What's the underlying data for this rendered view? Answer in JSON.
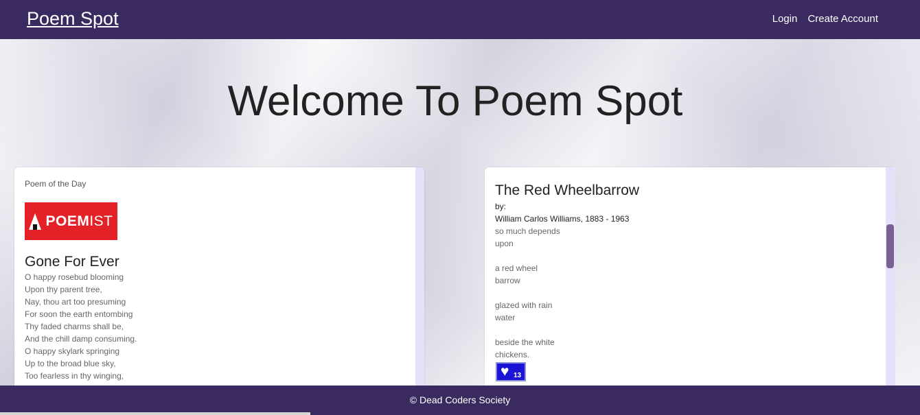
{
  "navbar": {
    "brand": "Poem Spot",
    "links": [
      "Login",
      "Create Account"
    ]
  },
  "hero": {
    "title": "Welcome To Poem Spot"
  },
  "poem_of_day": {
    "eyebrow": "Poem of the Day",
    "logo": {
      "prefix": "POEM",
      "suffix": "IST"
    },
    "title": "Gone For Ever",
    "lines": [
      "O happy rosebud blooming",
      "Upon thy parent tree,",
      "Nay, thou art too presuming",
      "For soon the earth entombing",
      "Thy faded charms shall be,",
      "And the chill damp consuming.",
      "O happy skylark springing",
      "Up to the broad blue sky,",
      "Too fearless in thy winging,"
    ]
  },
  "featured_poem": {
    "title": "The Red Wheelbarrow",
    "by_label": "by:",
    "author": "William Carlos Williams, 1883 - 1963",
    "lines": [
      "so much depends",
      "upon",
      "",
      "a red wheel",
      "barrow",
      "",
      "glazed with rain",
      "water",
      "",
      "beside the white",
      "chickens."
    ],
    "like_icon": "heart-icon",
    "likes": "13",
    "like_color": "#1b14d6"
  },
  "footer": {
    "text": "© Dead Coders Society"
  },
  "colors": {
    "nav_bg": "#3a2a5f",
    "accent_lavender": "#e6e0fb",
    "logo_red": "#e32127"
  }
}
